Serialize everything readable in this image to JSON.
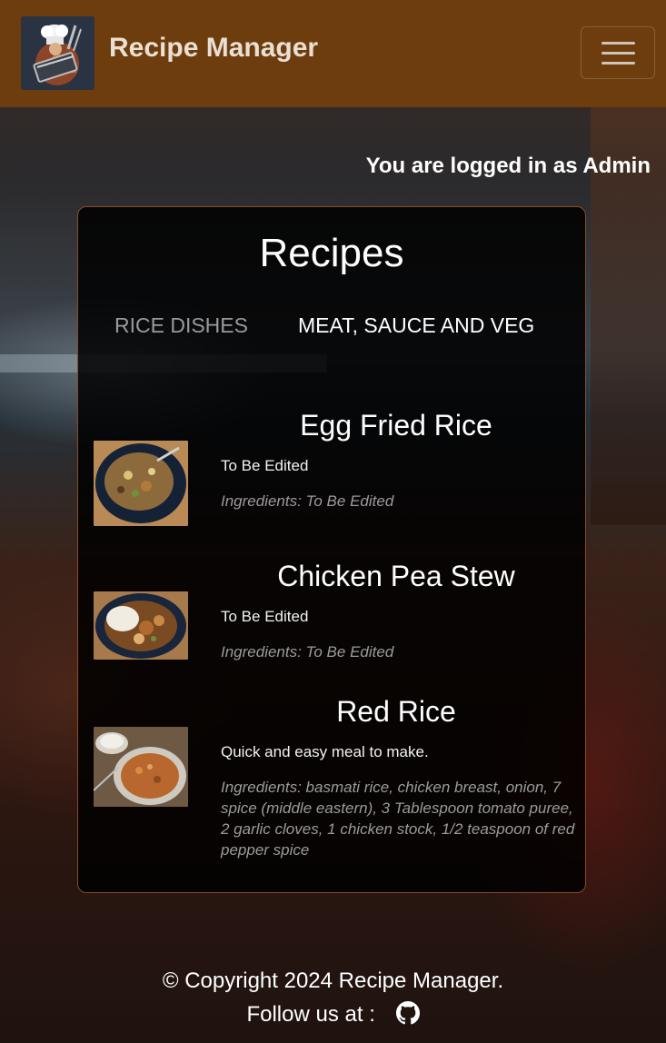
{
  "header": {
    "brand": "Recipe Manager",
    "logo_icon": "chef-hat-cookbook-logo",
    "menu_icon": "hamburger-menu-icon"
  },
  "status": {
    "logged_in_text": "You are logged in as Admin"
  },
  "recipes_card": {
    "title": "Recipes",
    "tabs": [
      {
        "label": "RICE DISHES",
        "active": false
      },
      {
        "label": "MEAT, SAUCE AND VEG",
        "active": true
      }
    ],
    "recipes": [
      {
        "name": "Egg Fried Rice",
        "description": "To Be Edited",
        "ingredients": "Ingredients: To Be Edited"
      },
      {
        "name": "Chicken Pea Stew",
        "description": "To Be Edited",
        "ingredients": "Ingredients: To Be Edited"
      },
      {
        "name": "Red Rice",
        "description": "Quick and easy meal to make.",
        "ingredients": "Ingredients: basmati rice, chicken breast, onion, 7 spice (middle eastern), 3 Tablespoon tomato puree, 2 garlic cloves, 1 chicken stock, 1/2 teaspoon of red pepper spice"
      }
    ]
  },
  "footer": {
    "copyright": "© Copyright 2024 Recipe Manager.",
    "follow_label": "Follow us at :",
    "social_icon": "github-icon"
  },
  "colors": {
    "navbar": "#6e3d0d",
    "card_border": "#8a4a22",
    "inactive_tab": "#9a9a9a",
    "ingredients_text": "#9b9b9b"
  }
}
